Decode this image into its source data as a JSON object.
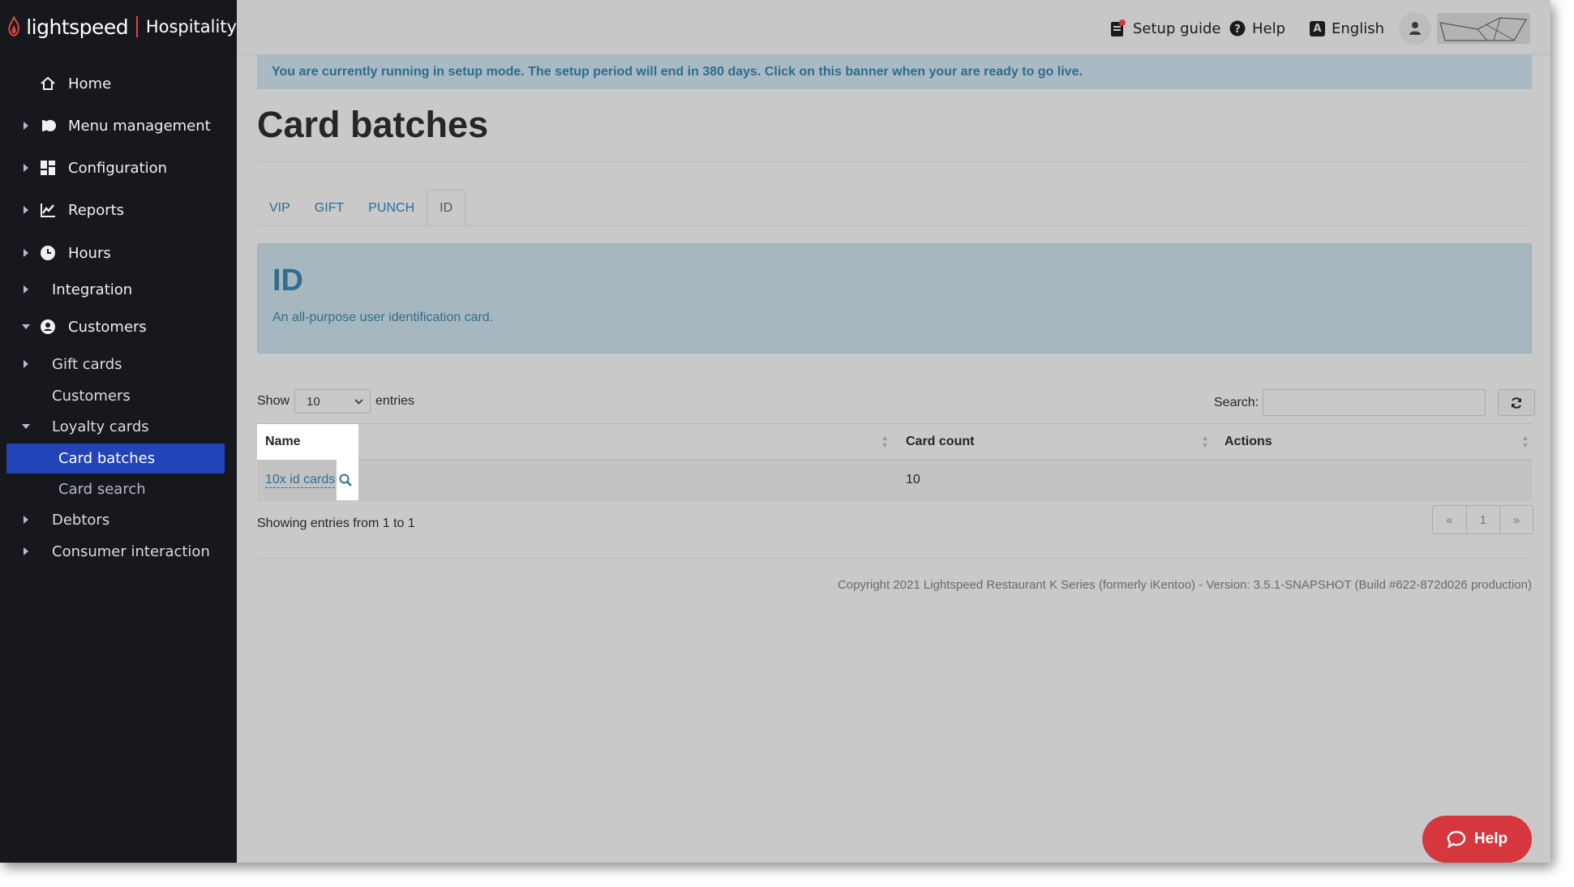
{
  "brand": {
    "name": "lightspeed",
    "product": "Hospitality"
  },
  "sidebar": {
    "items": [
      {
        "label": "Home"
      },
      {
        "label": "Menu management"
      },
      {
        "label": "Configuration"
      },
      {
        "label": "Reports"
      },
      {
        "label": "Hours"
      },
      {
        "label": "Integration"
      },
      {
        "label": "Customers"
      },
      {
        "label": "Gift cards"
      },
      {
        "label": "Customers"
      },
      {
        "label": "Loyalty cards"
      },
      {
        "label": "Card batches"
      },
      {
        "label": "Card search"
      },
      {
        "label": "Debtors"
      },
      {
        "label": "Consumer interaction"
      }
    ]
  },
  "topbar": {
    "setup_guide": "Setup guide",
    "help": "Help",
    "language_badge": "A",
    "language": "English"
  },
  "banner": "You are currently running in setup mode. The setup period will end in 380 days. Click on this banner when your are ready to go live.",
  "page": {
    "title": "Card batches"
  },
  "tabs": [
    {
      "label": "VIP"
    },
    {
      "label": "GIFT"
    },
    {
      "label": "PUNCH"
    },
    {
      "label": "ID"
    }
  ],
  "info": {
    "title": "ID",
    "description": "An all-purpose user identification card."
  },
  "controls": {
    "show_label": "Show",
    "entries_value": "10",
    "entries_label": "entries",
    "search_label": "Search:",
    "search_value": ""
  },
  "table": {
    "headers": {
      "name": "Name",
      "card_count": "Card count",
      "actions": "Actions"
    },
    "rows": [
      {
        "name": "10x id cards",
        "card_count": "10",
        "actions": ""
      }
    ]
  },
  "showing": "Showing entries from 1 to 1",
  "pagination": {
    "prev": "«",
    "page": "1",
    "next": "»"
  },
  "copyright": "Copyright 2021 Lightspeed Restaurant K Series (formerly iKentoo) - Version: 3.5.1-SNAPSHOT (Build #622-872d026 production)",
  "help_fab": "Help",
  "colors": {
    "sidebar_bg": "#16181d",
    "active_item": "#2344b8",
    "help_button": "#d6363d",
    "link": "#2a6e9a"
  }
}
